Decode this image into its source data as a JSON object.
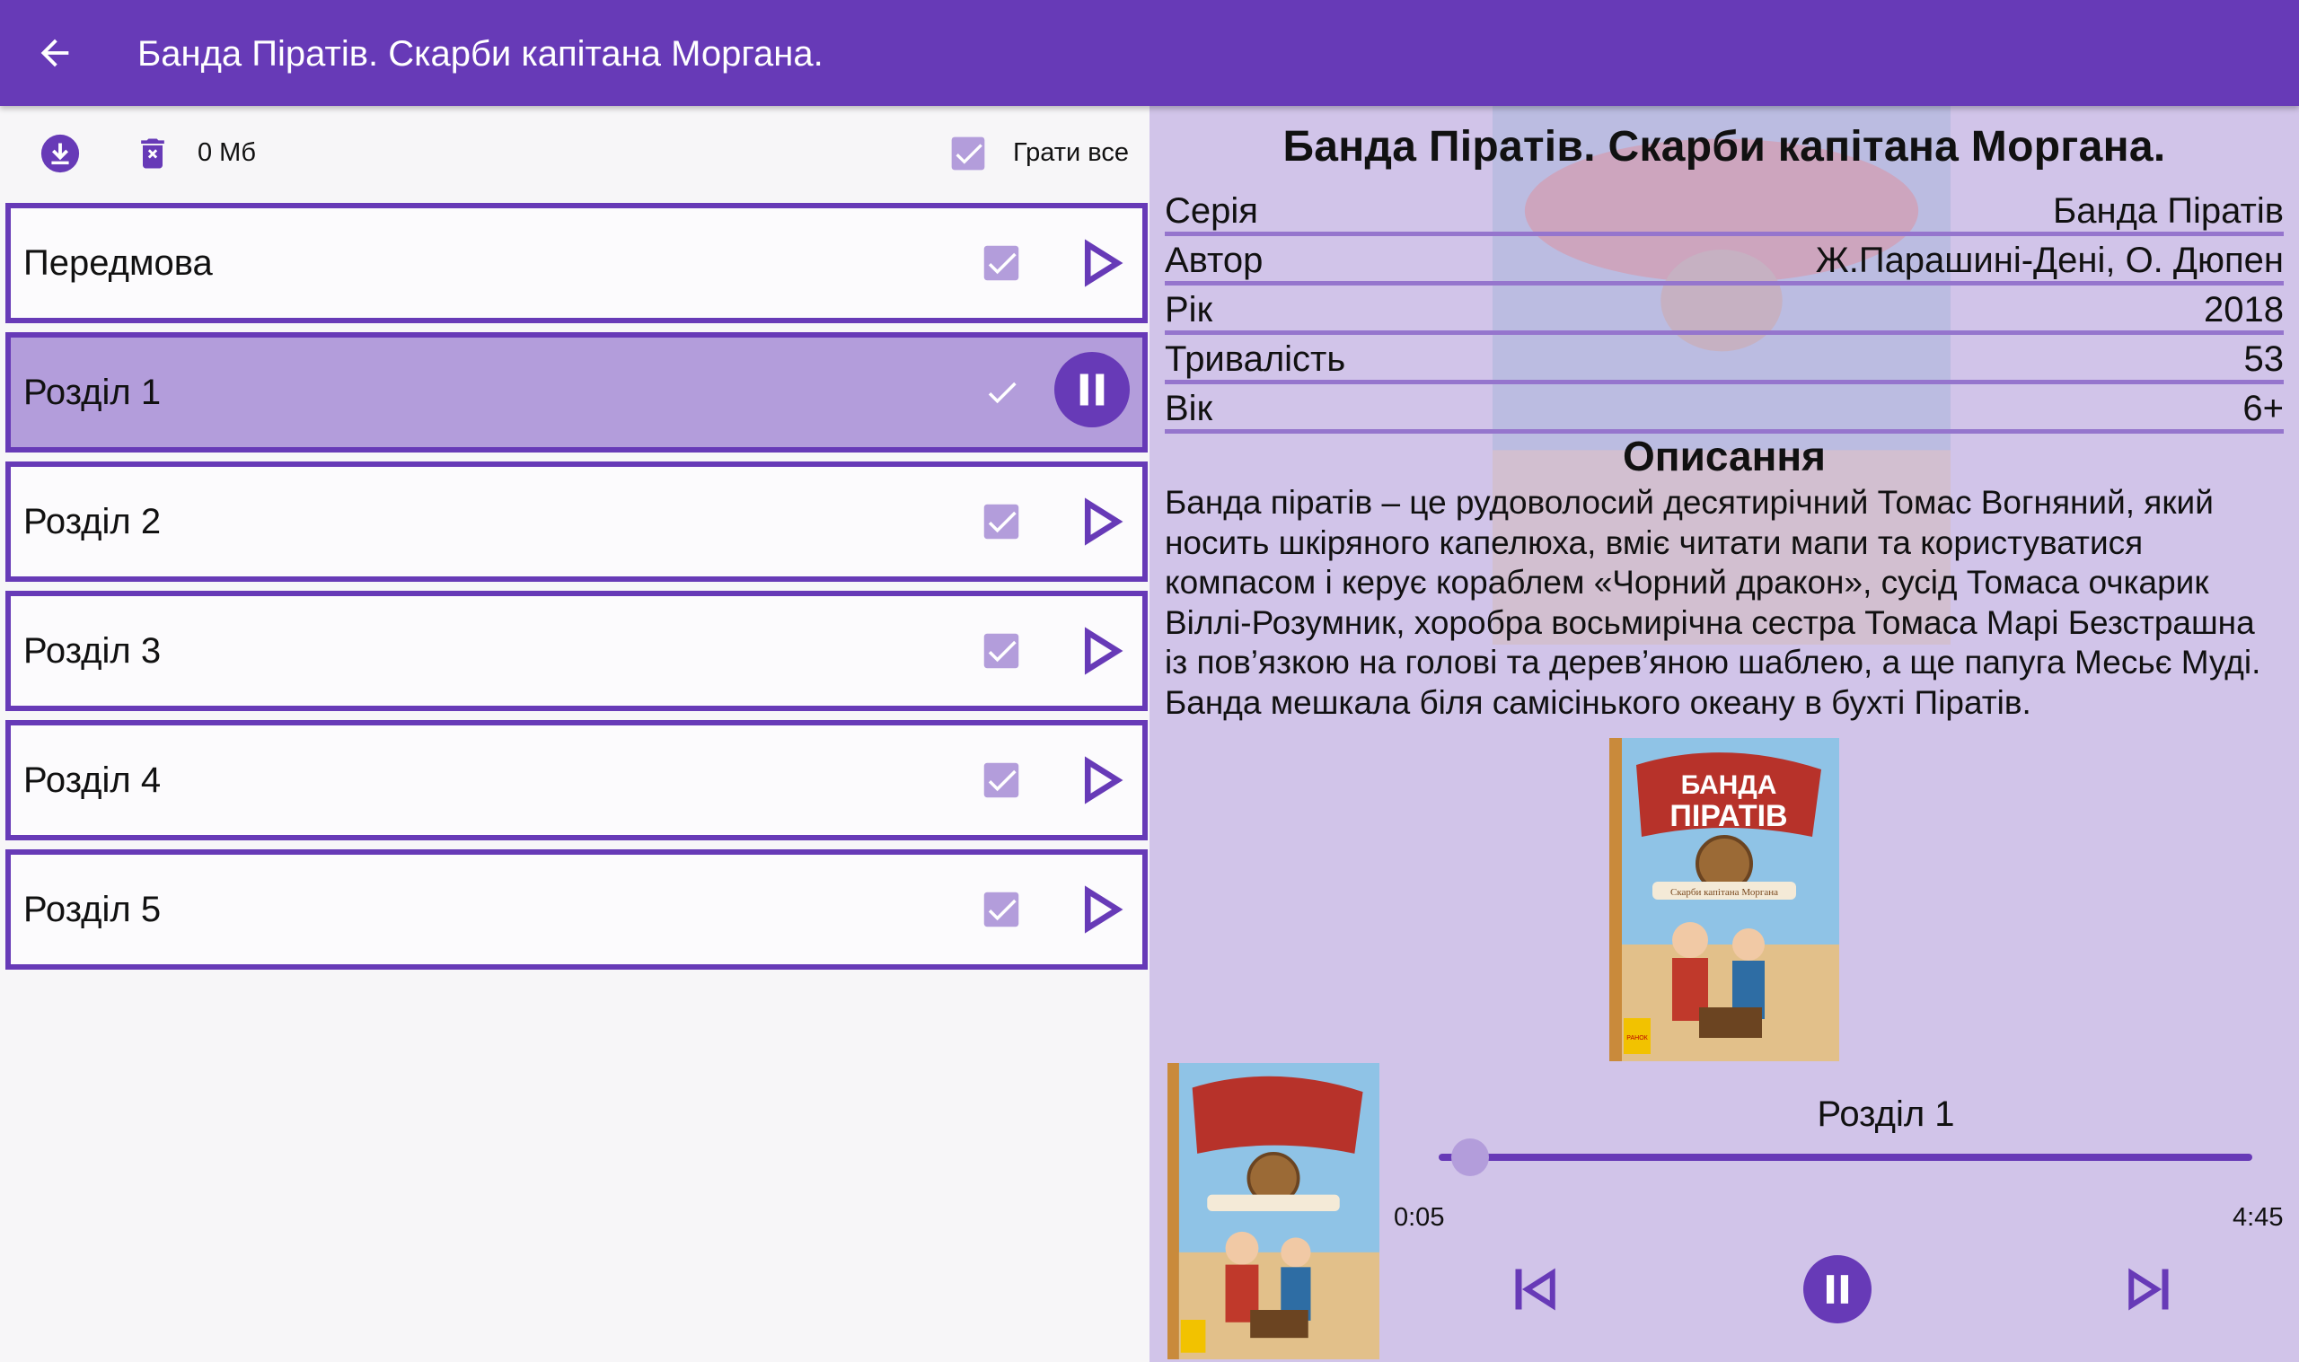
{
  "appbar": {
    "title": "Банда Піратів. Скарби капітана Моргана."
  },
  "toolbar": {
    "size": "0 Мб",
    "play_all": "Грати все"
  },
  "chapters": [
    {
      "label": "Передмова",
      "checked": true,
      "state": "play"
    },
    {
      "label": "Розділ 1",
      "checked": true,
      "state": "pause"
    },
    {
      "label": "Розділ 2",
      "checked": true,
      "state": "play"
    },
    {
      "label": "Розділ 3",
      "checked": true,
      "state": "play"
    },
    {
      "label": "Розділ 4",
      "checked": true,
      "state": "play"
    },
    {
      "label": "Розділ 5",
      "checked": true,
      "state": "play"
    }
  ],
  "book": {
    "title": "Банда Піратів. Скарби капітана Моргана.",
    "fields": [
      {
        "key": "Серія",
        "value": "Банда Піратів"
      },
      {
        "key": "Автор",
        "value": "Ж.Парашині-Дені, О. Дюпен"
      },
      {
        "key": "Рік",
        "value": "2018"
      },
      {
        "key": "Тривалість",
        "value": "53"
      },
      {
        "key": "Вік",
        "value": "6+"
      }
    ],
    "description_heading": "Описання",
    "description": "Банда піратів – це рудоволосий десятирічний Томас Вогняний, який носить шкіряного капелюха, вміє читати мапи та користуватися компасом і керує кораблем «Чорний дракон», сусід Томаса очкарик Віллі-Розумник, хоробра восьмирічна сестра Томаса Марі Безстрашна із пов’язкою на голові та дерев’яною шаблею, а ще папуга Месьє Муді. Банда мешкала біля самісінького океану в бухті Піратів."
  },
  "cover": {
    "title_line1": "БАНДА",
    "title_line2": "ПІРАТІВ",
    "subtitle": "Скарби капітана Моргана",
    "publisher": "РАНОК"
  },
  "player": {
    "track": "Розділ 1",
    "current_time": "0:05",
    "total_time": "4:45",
    "progress": 0.0175,
    "state": "playing"
  },
  "colors": {
    "primary": "#673ab7",
    "primary_light": "#b39ddb",
    "panel": "#d1c4e9",
    "divider": "#9575cd"
  }
}
